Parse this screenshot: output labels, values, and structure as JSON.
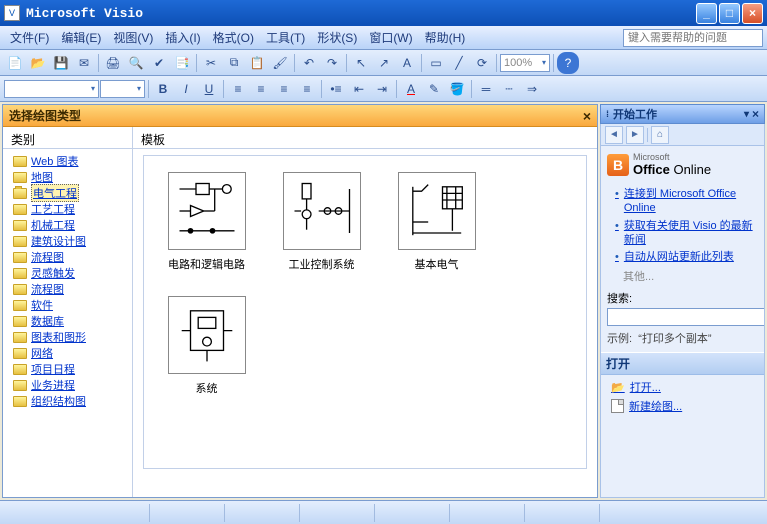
{
  "title": "Microsoft Visio",
  "menus": {
    "file": "文件(F)",
    "edit": "编辑(E)",
    "view": "视图(V)",
    "insert": "插入(I)",
    "format": "格式(O)",
    "tools": "工具(T)",
    "shape": "形状(S)",
    "window": "窗口(W)",
    "help": "帮助(H)"
  },
  "help_placeholder": "键入需要帮助的问题",
  "zoom": "100%",
  "doc": {
    "header": "选择绘图类型",
    "categories_label": "类别",
    "templates_label": "模板",
    "categories": [
      "Web 图表",
      "地图",
      "电气工程",
      "工艺工程",
      "机械工程",
      "建筑设计图",
      "流程图",
      "灵感触发",
      "流程图",
      "软件",
      "数据库",
      "图表和图形",
      "网络",
      "项目日程",
      "业务进程",
      "组织结构图"
    ],
    "selected_category_index": 2,
    "templates": [
      "电路和逻辑电路",
      "工业控制系统",
      "基本电气",
      "系统"
    ]
  },
  "taskpane": {
    "title": "开始工作",
    "office_small": "Microsoft",
    "office_big": "Office Online",
    "links": [
      "连接到 Microsoft Office Online",
      "获取有关使用 Visio 的最新新闻",
      "自动从网站更新此列表"
    ],
    "other": "其他...",
    "search_label": "搜索:",
    "example_prefix": "示例:",
    "example_text": "“打印多个副本”",
    "open_header": "打开",
    "open_link": "打开...",
    "new_link": "新建绘图..."
  }
}
